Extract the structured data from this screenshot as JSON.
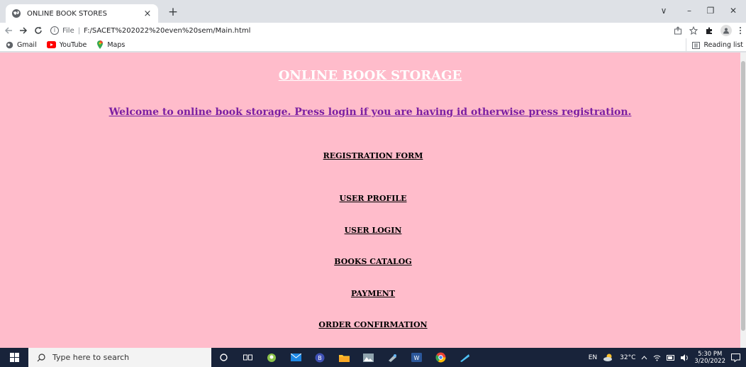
{
  "browser": {
    "tab_title": "ONLINE BOOK STORES",
    "tab_close": "×",
    "new_tab": "+",
    "url_scheme": "File",
    "url_path": "F:/SACET%202022%20even%20sem/Main.html",
    "window": {
      "minimize": "–",
      "maximize": "❐",
      "close": "✕",
      "tab_search": "∨"
    }
  },
  "bookmarks": {
    "items": [
      {
        "label": "Gmail",
        "icon": "globe-icon"
      },
      {
        "label": "YouTube",
        "icon": "youtube-icon"
      },
      {
        "label": "Maps",
        "icon": "maps-icon"
      }
    ],
    "reading_list": "Reading list"
  },
  "page": {
    "heading": "ONLINE BOOK STORAGE",
    "welcome": "Welcome to online book storage. Press login if you are having id otherwise press registration.",
    "links": [
      "REGISTRATION FORM",
      "USER PROFILE",
      "USER LOGIN",
      "BOOKS CATALOG",
      "PAYMENT",
      "ORDER CONFIRMATION"
    ]
  },
  "taskbar": {
    "search_placeholder": "Type here to search",
    "language": "EN",
    "weather": "32°C",
    "time": "5:30 PM",
    "date": "3/20/2022"
  },
  "colors": {
    "page_background": "#ffbccb",
    "heading": "#ffffff",
    "welcome": "#7b1fa2",
    "taskbar": "#18233a"
  }
}
